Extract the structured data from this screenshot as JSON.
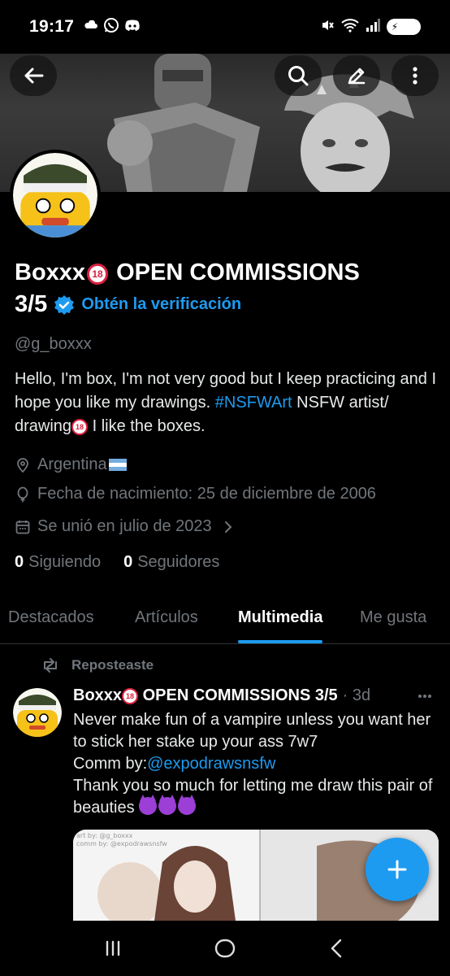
{
  "status_bar": {
    "time": "19:17",
    "battery": "76",
    "left_icons": [
      "cloud-icon",
      "whatsapp-icon",
      "discord-icon"
    ],
    "right_icons": [
      "mute-icon",
      "wifi-icon",
      "signal-icon",
      "battery-icon"
    ]
  },
  "header": {
    "back_icon": "back-arrow-icon",
    "search_icon": "search-icon",
    "edit_icon": "pencil-icon",
    "more_icon": "more-icon"
  },
  "profile": {
    "name_part1": "Boxxx",
    "badge_18": "18",
    "name_part2": " OPEN COMMISSIONS",
    "name_line2": "3/5",
    "get_verified": "Obtén la verificación",
    "handle": "@g_boxxx",
    "bio_part1": "Hello, I'm box, I'm not very good but I keep practicing and I hope you like my drawings.  ",
    "bio_hashtag": "#NSFWArt",
    "bio_part2": "  NSFW artist/ drawing",
    "bio_part3": "  I like the boxes.",
    "location": "Argentina",
    "birthday": "Fecha de nacimiento: 25 de diciembre de 2006",
    "joined": "Se unió en julio de 2023",
    "following_count": "0",
    "following_label": "Siguiendo",
    "followers_count": "0",
    "followers_label": "Seguidores"
  },
  "tabs": [
    {
      "label": "Destacados"
    },
    {
      "label": "Artículos"
    },
    {
      "label": "Multimedia"
    },
    {
      "label": "Me gusta"
    }
  ],
  "post": {
    "repost_label": "Reposteaste",
    "author_part1": "Boxxx",
    "author_badge": "18",
    "author_part2": " OPEN COMMISSIONS 3/5",
    "time": "· 3d",
    "line1": "Never make fun of a vampire unless you want her to stick her stake up your ass 7w7",
    "comm_prefix": "Comm by:",
    "mention": "@expodrawsnsfw",
    "line3": "Thank you so much for letting me draw this pair of beauties ",
    "media_watermark_1": "art by: @g_boxxx",
    "media_watermark_2": "comm by: @expodrawsnsfw"
  },
  "colors": {
    "accent": "#1d9bf0",
    "background": "#000000",
    "muted": "#71767b",
    "text": "#e7e9ea"
  },
  "navbar": [
    "recents-icon",
    "home-icon",
    "back-icon"
  ]
}
